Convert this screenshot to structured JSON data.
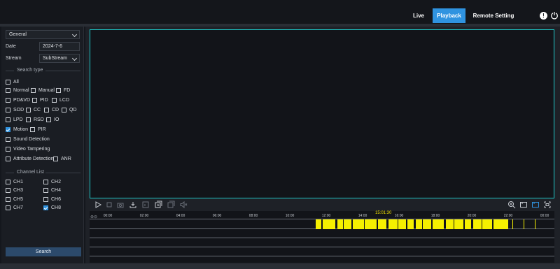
{
  "nav": {
    "tabs": [
      {
        "label": "Live",
        "active": false
      },
      {
        "label": "Playback",
        "active": true
      },
      {
        "label": "Remote Setting",
        "active": false
      }
    ],
    "info_icon": "info-icon",
    "power_icon": "power-icon",
    "accent_color": "#2f93e0"
  },
  "sidebar": {
    "mode_select": "General",
    "date_label": "Date",
    "date_value": "2024-7-6",
    "stream_label": "Stream",
    "stream_value": "SubStream",
    "search_type_title": "Search type",
    "search_types": [
      {
        "label": "All",
        "checked": false
      },
      {
        "label": "Normal",
        "checked": false
      },
      {
        "label": "Manual",
        "checked": false
      },
      {
        "label": "FD",
        "checked": false
      },
      {
        "label": "PD&VD",
        "checked": false
      },
      {
        "label": "PID",
        "checked": false
      },
      {
        "label": "LCD",
        "checked": false
      },
      {
        "label": "SOD",
        "checked": false
      },
      {
        "label": "CC",
        "checked": false
      },
      {
        "label": "CD",
        "checked": false
      },
      {
        "label": "QD",
        "checked": false
      },
      {
        "label": "LPD",
        "checked": false
      },
      {
        "label": "RSD",
        "checked": false
      },
      {
        "label": "IO",
        "checked": false
      },
      {
        "label": "Motion",
        "checked": true
      },
      {
        "label": "PIR",
        "checked": false
      },
      {
        "label": "Sound Detection",
        "checked": false
      },
      {
        "label": "Video Tampering",
        "checked": false
      },
      {
        "label": "Attribute Detection",
        "checked": false
      },
      {
        "label": "ANR",
        "checked": false
      }
    ],
    "channel_list_title": "Channel List",
    "channels": [
      {
        "label": "CH1",
        "checked": false
      },
      {
        "label": "CH2",
        "checked": false
      },
      {
        "label": "CH3",
        "checked": false
      },
      {
        "label": "CH4",
        "checked": false
      },
      {
        "label": "CH5",
        "checked": false
      },
      {
        "label": "CH6",
        "checked": false
      },
      {
        "label": "CH7",
        "checked": false
      },
      {
        "label": "CH8",
        "checked": true
      }
    ],
    "search_button": "Search"
  },
  "playback": {
    "video_border_color": "#1ec8c8",
    "controls_left": [
      "play-icon",
      "stop-icon",
      "snapshot-icon",
      "download-icon",
      "clip-icon",
      "multi-play-icon",
      "sync-play-icon",
      "mute-icon"
    ],
    "controls_right": [
      "zoom-in-icon",
      "aspect-ratio-icon",
      "fit-screen-icon",
      "fullscreen-icon"
    ],
    "timeline": {
      "current_time": "15:01:30",
      "hour_labels": [
        "00:00",
        "02:00",
        "04:00",
        "06:00",
        "08:00",
        "10:00",
        "12:00",
        "14:00",
        "16:00",
        "18:00",
        "20:00",
        "22:00",
        "00:00"
      ],
      "recording_color": "#f5f000"
    }
  }
}
